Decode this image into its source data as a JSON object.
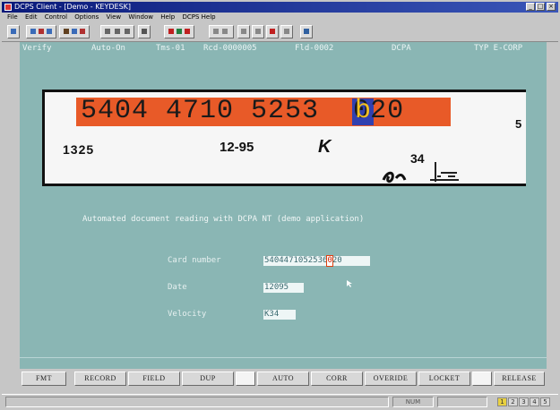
{
  "window": {
    "title": "DCPS Client - [Demo - KEYDESK]"
  },
  "menubar": {
    "items": [
      "File",
      "Edit",
      "Control",
      "Options",
      "View",
      "Window",
      "Help",
      "DCPS Help"
    ]
  },
  "screen": {
    "statusline": {
      "mode": "Verify",
      "auto": "Auto-On",
      "tms": "Tms-01",
      "rcd": "Rcd-0000005",
      "fld": "Fld-0002",
      "app": "DCPA",
      "typ": "TYP E-CORP"
    },
    "document_image": {
      "card_digits": "5404 4710 5253 ",
      "highlight_char": "b",
      "card_tail": "020",
      "side_char": "5",
      "line2_left": "1325",
      "line2_mid": "12-95",
      "line2_k": "K",
      "line2_right": "34"
    },
    "heading": "Automated document reading with DCPA NT (demo application)",
    "fields": {
      "card_number": {
        "label": "Card number",
        "value_before": "5404471052536",
        "cursor_char": "0",
        "value_after": "20"
      },
      "date": {
        "label": "Date",
        "value": "12095"
      },
      "velocity": {
        "label": "Velocity",
        "value": "K34"
      }
    }
  },
  "function_keys": [
    "FMT",
    "RECORD",
    "FIELD",
    "DUP",
    "",
    "AUTO",
    "CORR",
    "OVERIDE",
    "LOCKET",
    "",
    "RELEASE"
  ],
  "statusbar": {
    "center": "NUM",
    "leds": [
      "1",
      "2",
      "3",
      "4",
      "5"
    ]
  },
  "colors": {
    "screen_bg": "#8ab6b4",
    "title_bg": "#0a1a7a",
    "highlight_orange": "#e85a28",
    "highlight_blue": "#3040b0"
  }
}
